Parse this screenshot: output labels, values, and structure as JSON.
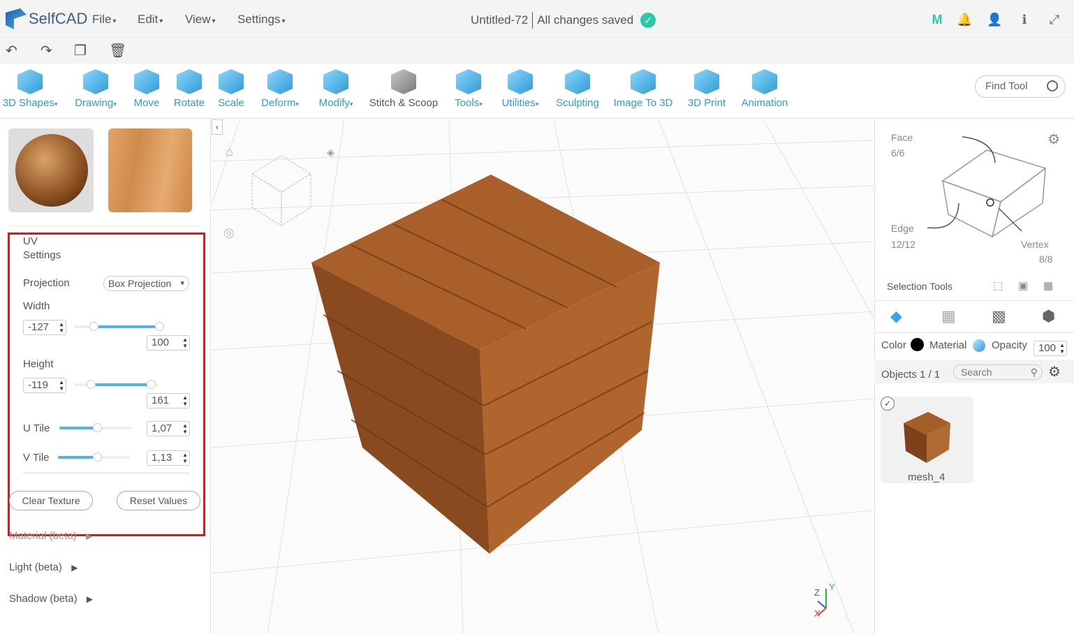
{
  "app": {
    "name": "SelfCAD",
    "document_title": "Untitled-72",
    "save_status": "All changes saved"
  },
  "menu": {
    "file": "File",
    "edit": "Edit",
    "view": "View",
    "settings": "Settings"
  },
  "top_right_icons": [
    "m-logo-icon",
    "bell-icon",
    "user-icon",
    "info-icon",
    "fullscreen-icon"
  ],
  "toolbar": {
    "tools": [
      "3D Shapes",
      "Drawing",
      "Move",
      "Rotate",
      "Scale",
      "Deform",
      "Modify",
      "Stitch & Scoop",
      "Tools",
      "Utilities",
      "Sculpting",
      "Image To 3D",
      "3D Print",
      "Animation"
    ],
    "find_tool": "Find Tool"
  },
  "uv": {
    "title_line1": "UV",
    "title_line2": "Settings",
    "projection_label": "Projection",
    "projection_value": "Box Projection",
    "width_label": "Width",
    "width_min": "-127",
    "width_max": "100",
    "height_label": "Height",
    "height_min": "-119",
    "height_max": "161",
    "u_tile_label": "U Tile",
    "u_tile_value": "1,07",
    "v_tile_label": "V Tile",
    "v_tile_value": "1,13",
    "clear_texture": "Clear Texture",
    "reset_values": "Reset Values"
  },
  "sections": {
    "material": "Material (beta)",
    "light": "Light (beta)",
    "shadow": "Shadow (beta)"
  },
  "selection": {
    "face_label": "Face",
    "face_value": "6/6",
    "edge_label": "Edge",
    "edge_value": "12/12",
    "vertex_label": "Vertex",
    "vertex_value": "8/8",
    "tools_label": "Selection Tools"
  },
  "props": {
    "color": "Color",
    "material": "Material",
    "opacity": "Opacity",
    "opacity_value": "100"
  },
  "objects": {
    "label": "Objects 1 / 1",
    "search_placeholder": "Search",
    "item_name": "mesh_4"
  },
  "axes": {
    "x": "X",
    "y": "Y",
    "z": "Z"
  },
  "colors": {
    "accent": "#2e9ad6",
    "highlight_border": "#e11111",
    "save_check": "#2fc8a6"
  }
}
